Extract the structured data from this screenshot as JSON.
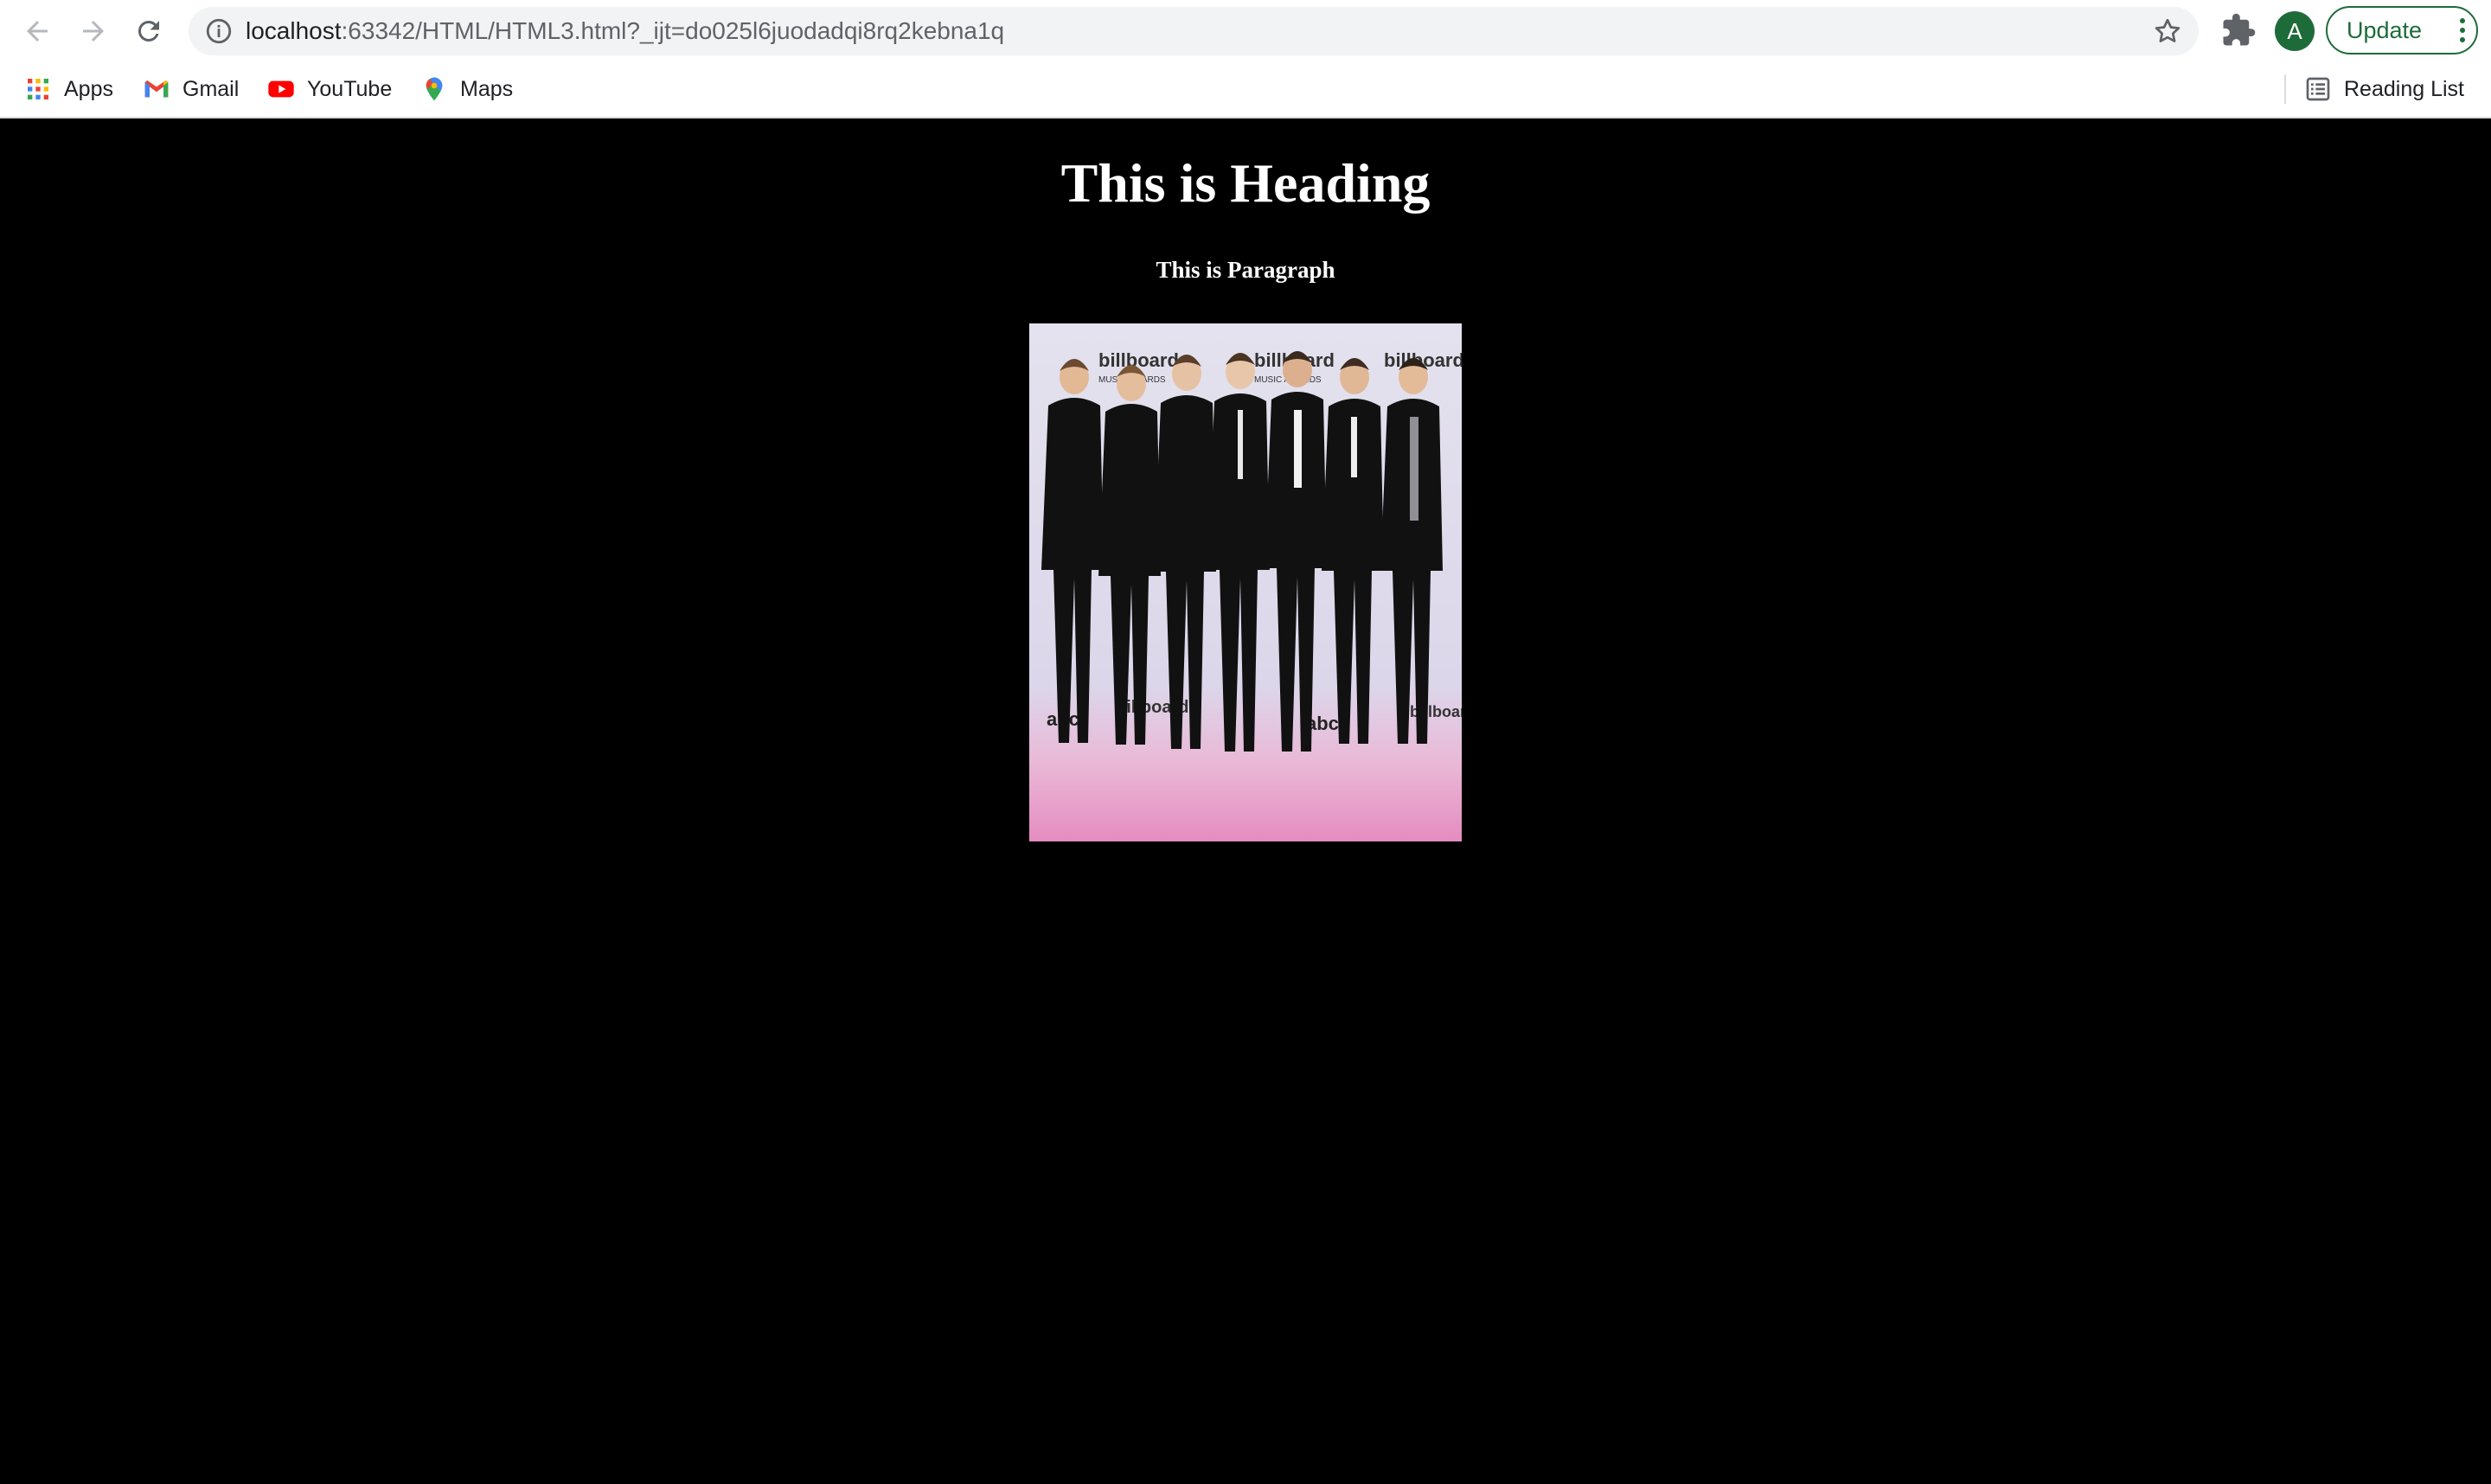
{
  "browser": {
    "url_host": "localhost",
    "url_rest": ":63342/HTML/HTML3.html?_ijt=do025l6juodadqi8rq2kebna1q",
    "avatar_letter": "A",
    "update_label": "Update",
    "bookmarks": [
      {
        "label": "Apps",
        "icon": "apps-grid-icon"
      },
      {
        "label": "Gmail",
        "icon": "gmail-icon"
      },
      {
        "label": "YouTube",
        "icon": "youtube-icon"
      },
      {
        "label": "Maps",
        "icon": "maps-icon"
      }
    ],
    "reading_list_label": "Reading List"
  },
  "page": {
    "heading": "This is Heading",
    "paragraph": "This is Paragraph",
    "photo_logo_texts": [
      "billboard",
      "MUSIC AWARDS",
      "abc"
    ]
  },
  "colors": {
    "page_background": "#000000",
    "page_text": "#ffffff",
    "accent_green": "#1e6b3a"
  }
}
